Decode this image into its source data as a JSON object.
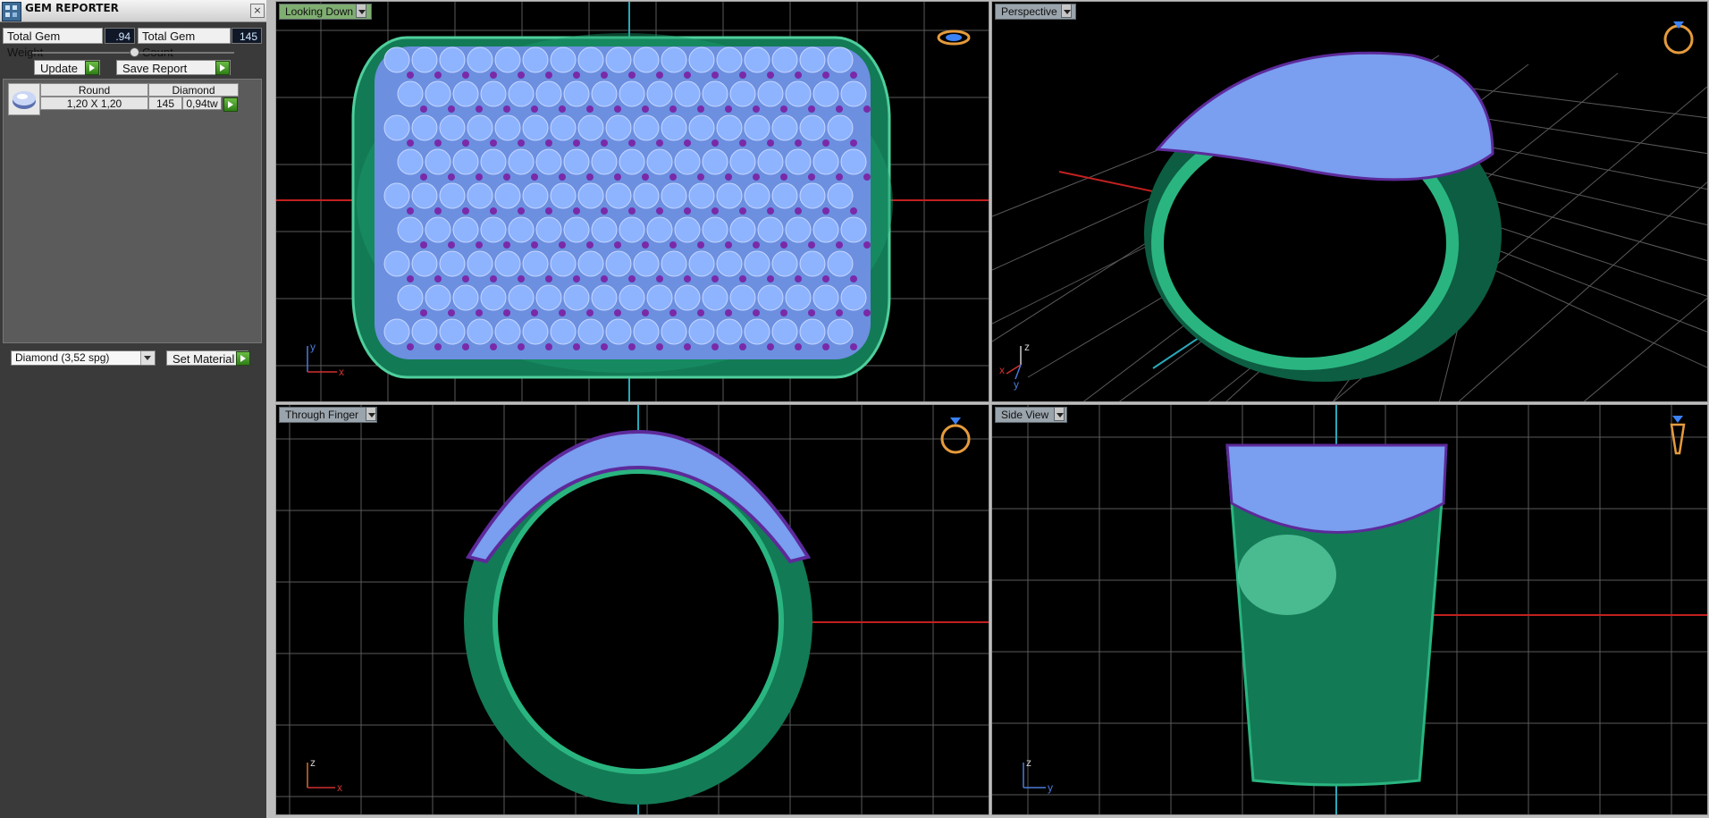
{
  "panel": {
    "title": "GEM REPORTER",
    "close": "×",
    "total_weight_label": "Total Gem Weight",
    "total_weight_value": ".94",
    "total_count_label": "Total Gem Count",
    "total_count_value": "145",
    "update_label": "Update",
    "save_report_label": "Save Report",
    "gem_rows": [
      {
        "shape": "Round",
        "material": "Diamond",
        "size": "1,20 X 1,20",
        "count": "145",
        "weight": "0,94tw"
      }
    ],
    "material_select": "Diamond    (3,52 spg)",
    "set_material_label": "Set Material"
  },
  "viewports": [
    {
      "label": "Looking Down",
      "axis_a": "y",
      "axis_b": "x"
    },
    {
      "label": "Perspective",
      "axis_a": "z",
      "axis_b": "x",
      "axis_c": "y"
    },
    {
      "label": "Through Finger",
      "axis_a": "z",
      "axis_b": "x"
    },
    {
      "label": "Side View",
      "axis_a": "z",
      "axis_b": "y"
    }
  ],
  "colors": {
    "metal": "#1d8a62",
    "gem": "#8fb4ff",
    "prong": "#7a2aa8",
    "grid": "#6a6a6a",
    "axis_red": "#c22020",
    "axis_cyan": "#2aa8b8"
  },
  "icons": {
    "app": "gem-reporter-icon",
    "nav": "ring-orientation-icon"
  }
}
